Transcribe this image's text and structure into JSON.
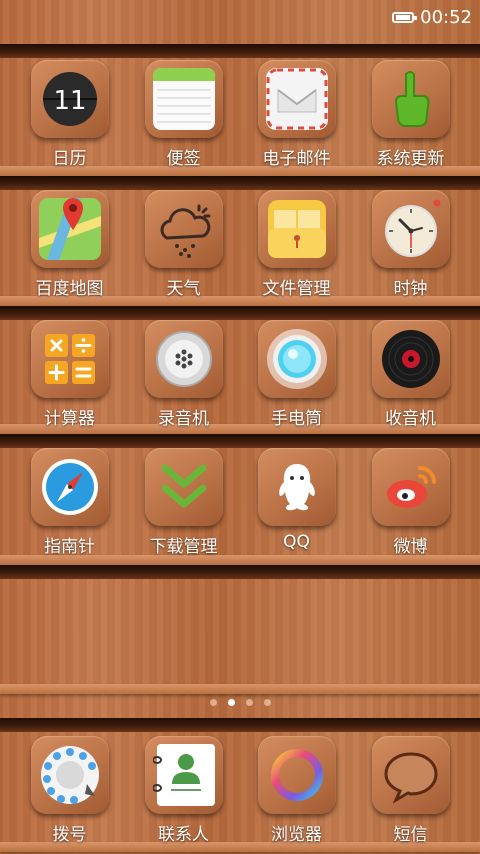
{
  "status": {
    "time": "00:52"
  },
  "rows": [
    [
      {
        "label": "日历",
        "icon": "calendar-icon",
        "day": "11"
      },
      {
        "label": "便签",
        "icon": "notes-icon"
      },
      {
        "label": "电子邮件",
        "icon": "mail-icon"
      },
      {
        "label": "系统更新",
        "icon": "system-update-icon"
      }
    ],
    [
      {
        "label": "百度地图",
        "icon": "map-icon"
      },
      {
        "label": "天气",
        "icon": "weather-icon"
      },
      {
        "label": "文件管理",
        "icon": "file-manager-icon"
      },
      {
        "label": "时钟",
        "icon": "clock-icon"
      }
    ],
    [
      {
        "label": "计算器",
        "icon": "calculator-icon"
      },
      {
        "label": "录音机",
        "icon": "recorder-icon"
      },
      {
        "label": "手电筒",
        "icon": "flashlight-icon"
      },
      {
        "label": "收音机",
        "icon": "radio-icon"
      }
    ],
    [
      {
        "label": "指南针",
        "icon": "compass-icon"
      },
      {
        "label": "下载管理",
        "icon": "download-icon"
      },
      {
        "label": "QQ",
        "icon": "qq-icon"
      },
      {
        "label": "微博",
        "icon": "weibo-icon"
      }
    ]
  ],
  "page_indicator": {
    "count": 4,
    "active": 2
  },
  "dock": [
    {
      "label": "拨号",
      "icon": "dialer-icon"
    },
    {
      "label": "联系人",
      "icon": "contacts-icon"
    },
    {
      "label": "浏览器",
      "icon": "browser-icon"
    },
    {
      "label": "短信",
      "icon": "messages-icon"
    }
  ]
}
